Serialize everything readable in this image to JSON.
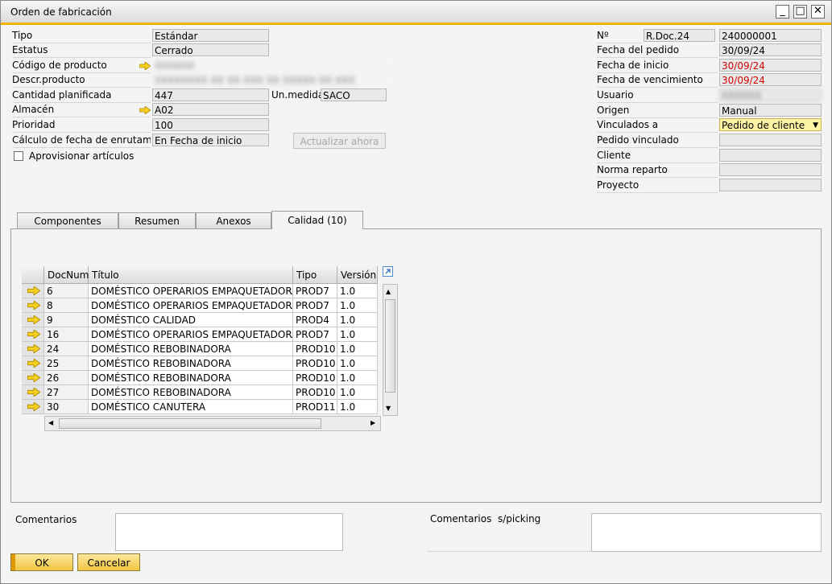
{
  "window": {
    "title": "Orden de fabricación"
  },
  "left": {
    "tipo": {
      "label": "Tipo",
      "value": "Estándar"
    },
    "estatus": {
      "label": "Estatus",
      "value": "Cerrado"
    },
    "codigo": {
      "label": "Código de producto",
      "value": "XXXXXX"
    },
    "descr": {
      "label": "Descr.producto",
      "value": "XXXXXXXX XX XX XXX XX XXXXX XX XXX"
    },
    "cantidad": {
      "label": "Cantidad planificada",
      "value": "447"
    },
    "unmedida": {
      "label": "Un.medida",
      "value": "SACO"
    },
    "almacen": {
      "label": "Almacén",
      "value": "A02"
    },
    "prioridad": {
      "label": "Prioridad",
      "value": "100"
    },
    "calculo": {
      "label": "Cálculo de fecha de enrutamier",
      "value": "En Fecha de inicio"
    },
    "actualizar_label": "Actualizar ahora",
    "aprovisionar_label": "Aprovisionar artículos"
  },
  "right": {
    "no": {
      "label": "Nº",
      "series": "R.Doc.24",
      "value": "240000001"
    },
    "fecha_pedido": {
      "label": "Fecha del pedido",
      "value": "30/09/24"
    },
    "fecha_inicio": {
      "label": "Fecha de inicio",
      "value": "30/09/24"
    },
    "fecha_venc": {
      "label": "Fecha de vencimiento",
      "value": "30/09/24"
    },
    "usuario": {
      "label": "Usuario",
      "value": "XXXXXX"
    },
    "origen": {
      "label": "Origen",
      "value": "Manual"
    },
    "vinculados": {
      "label": "Vinculados a",
      "value": "Pedido de cliente"
    },
    "pedido_vinc": {
      "label": "Pedido vinculado",
      "value": ""
    },
    "cliente": {
      "label": "Cliente",
      "value": ""
    },
    "norma": {
      "label": "Norma reparto",
      "value": ""
    },
    "proyecto": {
      "label": "Proyecto",
      "value": ""
    }
  },
  "tabs": [
    {
      "label": "Componentes"
    },
    {
      "label": "Resumen"
    },
    {
      "label": "Anexos"
    },
    {
      "label": "Calidad (10)"
    }
  ],
  "grid": {
    "columns": [
      "DocNum",
      "Título",
      "Tipo",
      "Versión"
    ],
    "rows": [
      {
        "docnum": "6",
        "titulo": "DOMÉSTICO OPERARIOS EMPAQUETADORA",
        "tipo": "PROD7",
        "version": "1.0"
      },
      {
        "docnum": "8",
        "titulo": "DOMÉSTICO OPERARIOS EMPAQUETADORA",
        "tipo": "PROD7",
        "version": "1.0"
      },
      {
        "docnum": "9",
        "titulo": "DOMÉSTICO CALIDAD",
        "tipo": "PROD4",
        "version": "1.0"
      },
      {
        "docnum": "16",
        "titulo": "DOMÉSTICO OPERARIOS EMPAQUETADORA",
        "tipo": "PROD7",
        "version": "1.0"
      },
      {
        "docnum": "24",
        "titulo": "DOMÉSTICO REBOBINADORA",
        "tipo": "PROD10",
        "version": "1.0"
      },
      {
        "docnum": "25",
        "titulo": "DOMÉSTICO REBOBINADORA",
        "tipo": "PROD10",
        "version": "1.0"
      },
      {
        "docnum": "26",
        "titulo": "DOMÉSTICO REBOBINADORA",
        "tipo": "PROD10",
        "version": "1.0"
      },
      {
        "docnum": "27",
        "titulo": "DOMÉSTICO REBOBINADORA",
        "tipo": "PROD10",
        "version": "1.0"
      },
      {
        "docnum": "30",
        "titulo": "DOMÉSTICO CANUTERA",
        "tipo": "PROD11",
        "version": "1.0"
      }
    ]
  },
  "comments": {
    "label": "Comentarios",
    "picking_label": "Comentarios  s/picking"
  },
  "buttons": {
    "ok": "OK",
    "cancel": "Cancelar"
  }
}
